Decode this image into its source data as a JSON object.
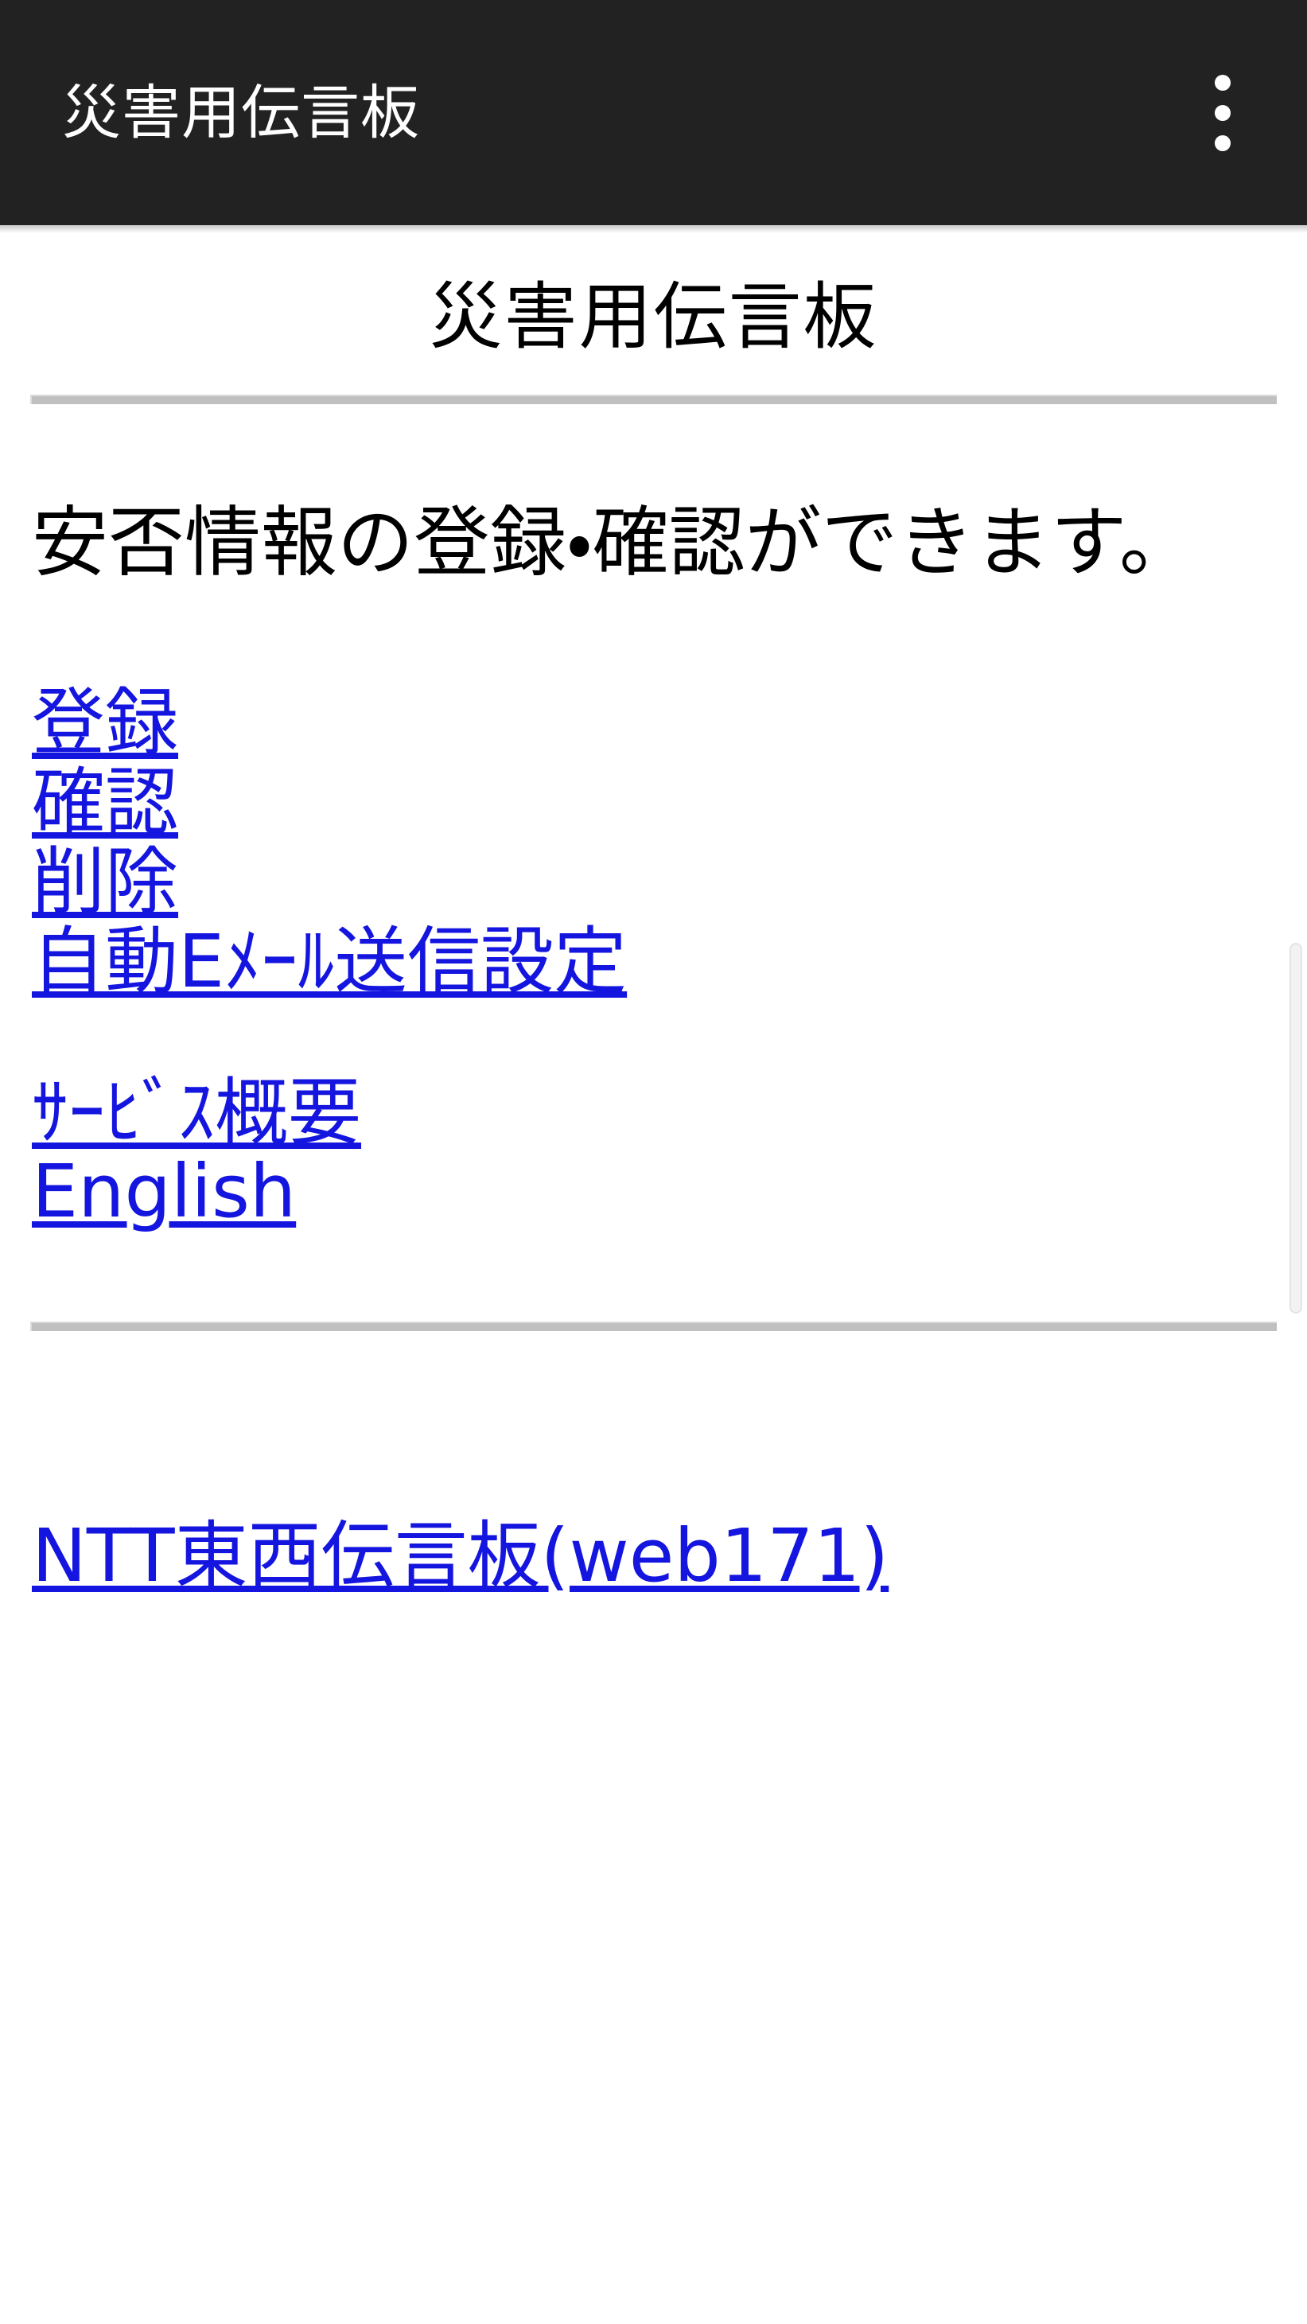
{
  "appbar": {
    "title": "災害用伝言板",
    "overflow_menu_label": "⋮",
    "background_color": "#222222",
    "text_color": "#ffffff"
  },
  "page": {
    "heading": "災害用伝言板",
    "body_text": "安否情報の登録・確認ができます。",
    "link_color": "#1515e0",
    "rule_color": "#c0c0c0",
    "background_color": "#ffffff"
  },
  "primary_links": [
    {
      "label": "登録"
    },
    {
      "label": "確認"
    },
    {
      "label": "削除"
    },
    {
      "label": "自動Eﾒｰﾙ送信設定"
    }
  ],
  "secondary_links": [
    {
      "label": "ｻｰﾋﾞｽ概要"
    },
    {
      "label": "English"
    }
  ],
  "footer_links": [
    {
      "label": "NTT東西伝言板(web171)"
    }
  ],
  "scrollbar": {
    "orientation": "vertical",
    "thumb_color": "#f2f2f2"
  }
}
